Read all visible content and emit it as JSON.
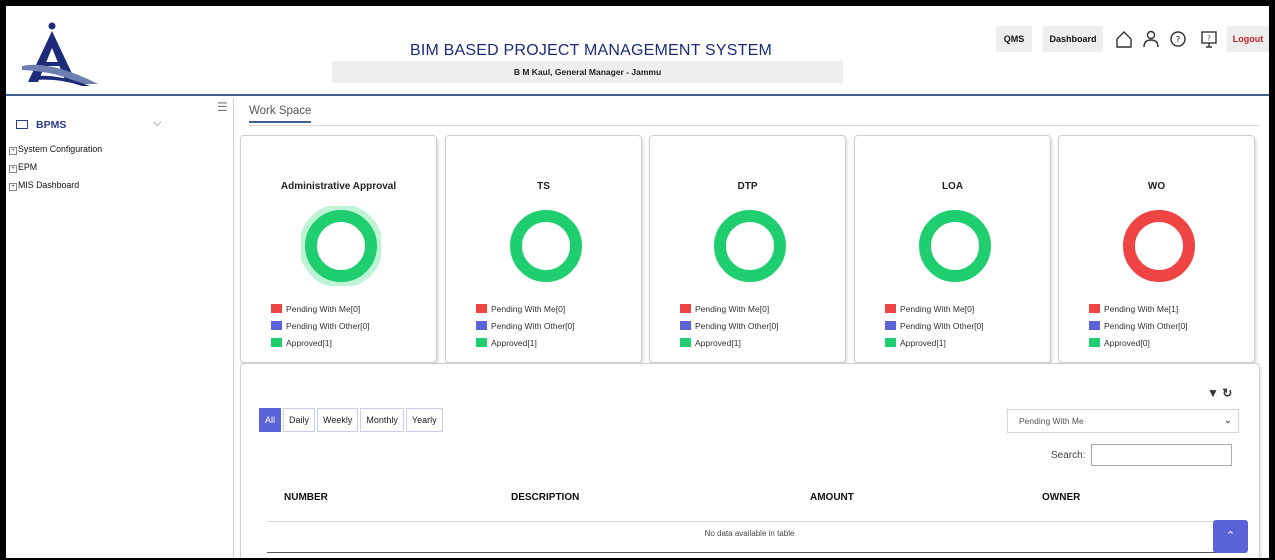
{
  "header": {
    "title": "BIM BASED PROJECT MANAGEMENT SYSTEM",
    "subtitle": "B M Kaul, General Manager - Jammu",
    "qms": "QMS",
    "dashboard": "Dashboard",
    "logout": "Logout"
  },
  "sidebar": {
    "root": "BPMS",
    "items": [
      {
        "label": "System Configuration"
      },
      {
        "label": "EPM"
      },
      {
        "label": "MIS Dashboard"
      }
    ]
  },
  "workspace": {
    "tab": "Work Space"
  },
  "cards": [
    {
      "title": "Administrative Approval",
      "legend": [
        "Pending With Me[0]",
        "Pending With Other[0]",
        "Approved[1]"
      ],
      "pending_me": 0,
      "pending_other": 0,
      "approved": 1
    },
    {
      "title": "TS",
      "legend": [
        "Pending With Me[0]",
        "Pending With Other[0]",
        "Approved[1]"
      ],
      "pending_me": 0,
      "pending_other": 0,
      "approved": 1
    },
    {
      "title": "DTP",
      "legend": [
        "Pending With Me[0]",
        "Pending With Other[0]",
        "Approved[1]"
      ],
      "pending_me": 0,
      "pending_other": 0,
      "approved": 1
    },
    {
      "title": "LOA",
      "legend": [
        "Pending With Me[0]",
        "Pending With Other[0]",
        "Approved[1]"
      ],
      "pending_me": 0,
      "pending_other": 0,
      "approved": 1
    },
    {
      "title": "WO",
      "legend": [
        "Pending With Me[1]",
        "Pending With Other[0]",
        "Approved[0]"
      ],
      "pending_me": 1,
      "pending_other": 0,
      "approved": 0
    }
  ],
  "colors": {
    "pending_me": "#ee4444",
    "pending_other": "#5b63d9",
    "approved": "#1fcf6f",
    "accent": "#5b63d9"
  },
  "table": {
    "filters": [
      "All",
      "Daily",
      "Weekly",
      "Monthly",
      "Yearly"
    ],
    "active_filter": "All",
    "status_select": "Pending With Me",
    "search_label": "Search:",
    "search_value": "",
    "columns": [
      "NUMBER",
      "DESCRIPTION",
      "AMOUNT",
      "OWNER"
    ],
    "empty_message": "No data available in table"
  }
}
